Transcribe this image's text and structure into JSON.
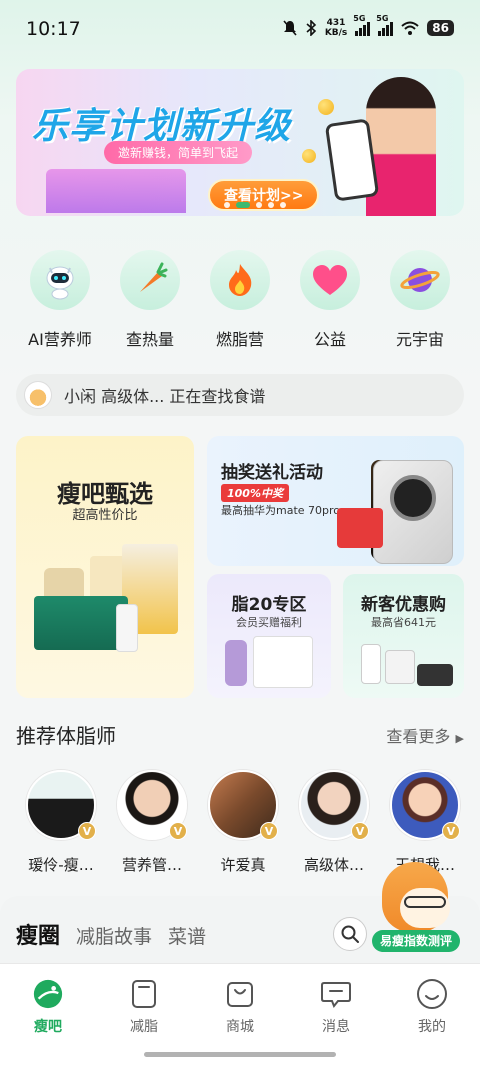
{
  "status_bar": {
    "time": "10:17",
    "net_speed_top": "431",
    "net_speed_bottom": "KB/s",
    "signal1_tag": "5G",
    "signal2_tag": "5G",
    "battery": "86"
  },
  "banner": {
    "title": "乐享计划新升级",
    "subtitle": "邀新赚钱，简单到飞起",
    "button": "查看计划>>",
    "dots_total": 5,
    "dots_active_index": 1
  },
  "quick_actions": [
    {
      "label": "AI营养师",
      "icon": "robot-icon"
    },
    {
      "label": "查热量",
      "icon": "carrot-icon"
    },
    {
      "label": "燃脂营",
      "icon": "flame-icon"
    },
    {
      "label": "公益",
      "icon": "heart-icon"
    },
    {
      "label": "元宇宙",
      "icon": "planet-icon"
    }
  ],
  "ticker": {
    "text": "小闲 高级体...  正在查找食谱"
  },
  "promos": {
    "big": {
      "title": "瘦吧甄选",
      "subtitle": "超高性价比"
    },
    "top_right": {
      "title": "抽奖送礼活动",
      "badge": "100%中奖",
      "subtitle": "最高抽华为mate 70pro"
    },
    "small_left": {
      "title": "脂20专区",
      "subtitle": "会员买赠福利"
    },
    "small_right": {
      "title": "新客优惠购",
      "subtitle": "最高省641元"
    }
  },
  "coaches_section": {
    "title": "推荐体脂师",
    "see_more": "查看更多",
    "coaches": [
      {
        "name": "瑷伶-瘦…",
        "verified": "V"
      },
      {
        "name": "营养管…",
        "verified": "V"
      },
      {
        "name": "许爱真",
        "verified": "V"
      },
      {
        "name": "高级体…",
        "verified": "V"
      },
      {
        "name": "王想我…",
        "verified": "V"
      }
    ]
  },
  "feed_tabs": {
    "tabs": [
      "瘦圈",
      "减脂故事",
      "菜谱"
    ],
    "active": "瘦圈"
  },
  "floating_badge": {
    "label": "易瘦指数测评"
  },
  "bottom_nav": {
    "items": [
      {
        "label": "瘦吧",
        "icon": "home-planet-icon",
        "active": true
      },
      {
        "label": "减脂",
        "icon": "notebook-icon",
        "active": false
      },
      {
        "label": "商城",
        "icon": "shopping-bag-icon",
        "active": false
      },
      {
        "label": "消息",
        "icon": "message-icon",
        "active": false
      },
      {
        "label": "我的",
        "icon": "smile-icon",
        "active": false
      }
    ]
  },
  "colors": {
    "accent": "#1faa5e",
    "banner_title": "#1fa6e8",
    "banner_button": "#ff7a12"
  }
}
